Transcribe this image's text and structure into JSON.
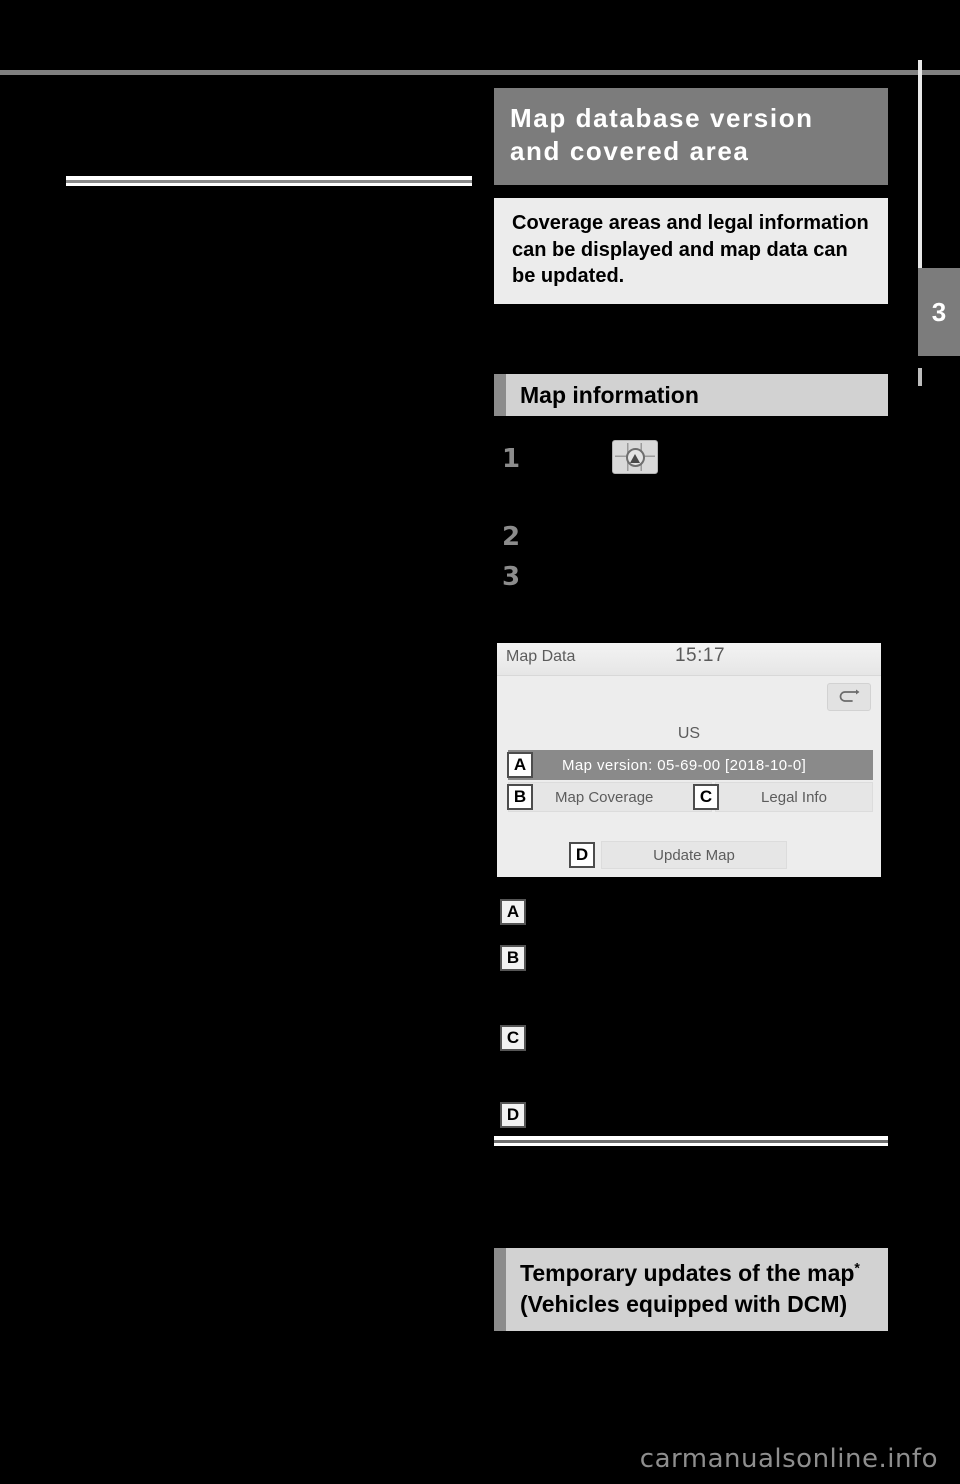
{
  "page": {
    "chapter_tab": "3",
    "watermark": "carmanualsonline.info"
  },
  "section": {
    "title": "Map database version and covered area",
    "lead": "Coverage areas and legal information can be displayed and map data can be updated."
  },
  "subsection": {
    "title": "Map information"
  },
  "steps": [
    {
      "number": "1",
      "icon": "map-menu-icon"
    },
    {
      "number": "2"
    },
    {
      "number": "3"
    }
  ],
  "screenshot": {
    "app_title": "Map Data",
    "clock": "15:17",
    "back_icon": "back-arrow-icon",
    "region_label": "US",
    "map_version_row": "Map version: 05-69-00  [2018-10-0]",
    "buttons": {
      "map_coverage": "Map Coverage",
      "legal_info": "Legal Info",
      "update_map": "Update Map"
    },
    "callouts": {
      "a": "A",
      "b": "B",
      "c": "C",
      "d": "D"
    }
  },
  "callout_list": [
    {
      "letter": "A"
    },
    {
      "letter": "B"
    },
    {
      "letter": "C"
    },
    {
      "letter": "D"
    }
  ],
  "bottom_block": {
    "title_part1": "Temporary updates of the map",
    "footnote_mark": "*",
    "title_part2": " (Vehicles equipped with DCM)"
  },
  "colors": {
    "section_header_bg": "#7c7c7c",
    "lead_bg": "#ececec",
    "subhead_bg": "#d2d2d2",
    "subhead_edge": "#8c8c8c",
    "page_bg": "#000000",
    "selected_row": "#8a8a8a"
  }
}
